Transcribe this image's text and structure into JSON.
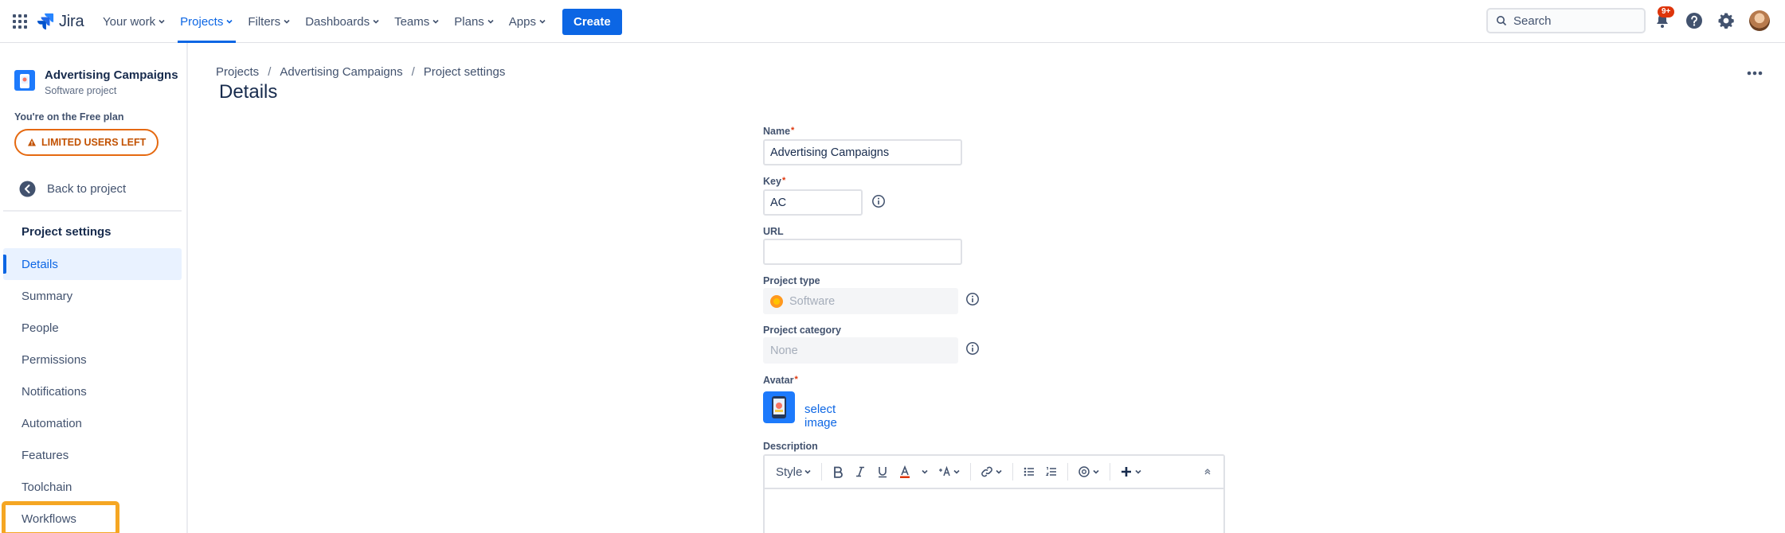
{
  "topnav": {
    "logo_text": "Jira",
    "items": [
      {
        "label": "Your work",
        "active": false
      },
      {
        "label": "Projects",
        "active": true
      },
      {
        "label": "Filters",
        "active": false
      },
      {
        "label": "Dashboards",
        "active": false
      },
      {
        "label": "Teams",
        "active": false
      },
      {
        "label": "Plans",
        "active": false
      },
      {
        "label": "Apps",
        "active": false
      }
    ],
    "create_label": "Create",
    "search_placeholder": "Search",
    "notifications_badge": "9+",
    "accent": "#0c66e4"
  },
  "sidebar": {
    "project_name": "Advertising Campaigns",
    "project_type": "Software project",
    "plan_text": "You're on the Free plan",
    "limited_users_label": "LIMITED USERS LEFT",
    "back_label": "Back to project",
    "section_title": "Project settings",
    "items": [
      {
        "label": "Details"
      },
      {
        "label": "Summary"
      },
      {
        "label": "People"
      },
      {
        "label": "Permissions"
      },
      {
        "label": "Notifications"
      },
      {
        "label": "Automation"
      },
      {
        "label": "Features"
      },
      {
        "label": "Toolchain"
      },
      {
        "label": "Workflows"
      }
    ],
    "selected": "Details",
    "highlighted": "Workflows"
  },
  "main": {
    "breadcrumbs": [
      "Projects",
      "Advertising Campaigns",
      "Project settings"
    ],
    "title": "Details"
  },
  "form": {
    "name_label": "Name",
    "name_value": "Advertising Campaigns",
    "key_label": "Key",
    "key_value": "AC",
    "url_label": "URL",
    "url_value": "",
    "project_type_label": "Project type",
    "project_type_value": "Software",
    "project_category_label": "Project category",
    "project_category_value": "None",
    "avatar_label": "Avatar",
    "select_image_label": "select image",
    "description_label": "Description",
    "toolbar_style_label": "Style",
    "required_mark": "*"
  }
}
